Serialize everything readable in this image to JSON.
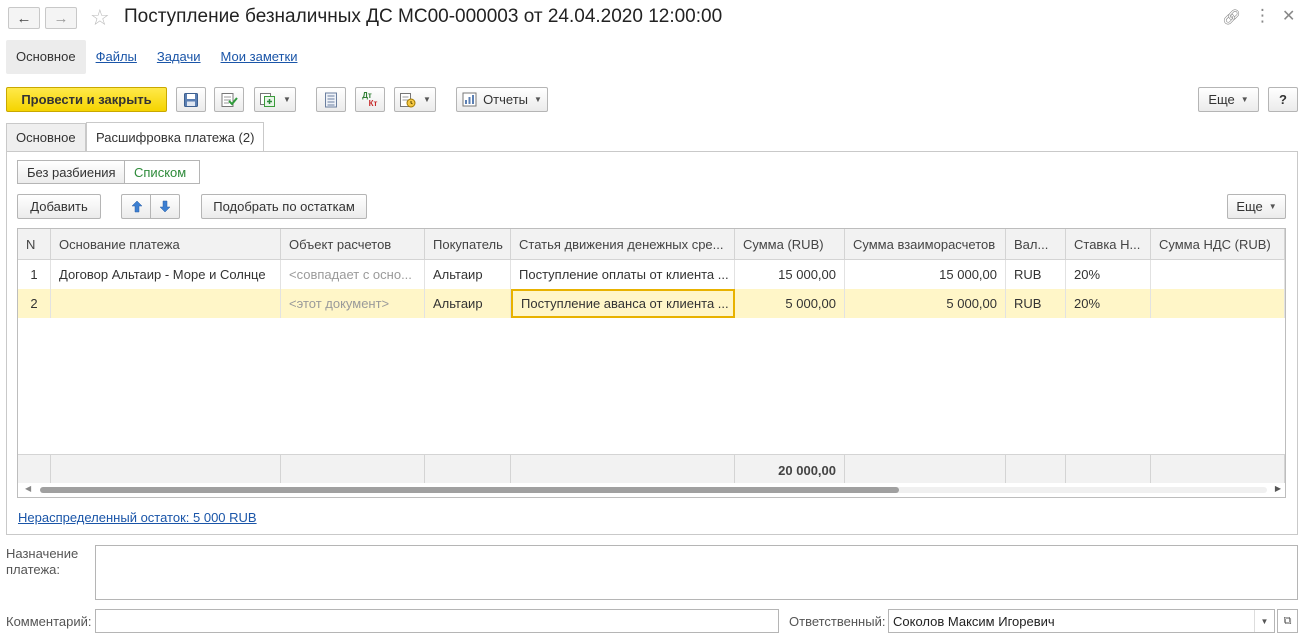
{
  "window": {
    "title": "Поступление безналичных ДС МС00-000003 от 24.04.2020 12:00:00"
  },
  "section_tabs": [
    {
      "label": "Основное"
    },
    {
      "label": "Файлы"
    },
    {
      "label": "Задачи"
    },
    {
      "label": "Мои заметки"
    }
  ],
  "toolbar": {
    "post_close": "Провести и закрыть",
    "reports": "Отчеты",
    "more": "Еще",
    "help": "?",
    "dtkt_top": "Дт",
    "dtkt_bottom": "Кт"
  },
  "tabs": [
    {
      "label": "Основное"
    },
    {
      "label": "Расшифровка платежа (2)"
    }
  ],
  "view_toggle": {
    "no_split": "Без разбиения",
    "list": "Списком"
  },
  "table_toolbar": {
    "add": "Добавить",
    "pick_by_balance": "Подобрать по остаткам",
    "more": "Еще"
  },
  "table": {
    "columns": [
      "N",
      "Основание платежа",
      "Объект расчетов",
      "Покупатель",
      "Статья движения денежных сре...",
      "Сумма (RUB)",
      "Сумма взаиморасчетов",
      "Вал...",
      "Ставка Н...",
      "Сумма НДС (RUB)"
    ],
    "rows": [
      [
        "1",
        "Договор Альтаир - Море и Солнце",
        "<совпадает с осно...",
        "Альтаир",
        "Поступление оплаты от клиента ...",
        "15 000,00",
        "15 000,00",
        "RUB",
        "20%",
        ""
      ],
      [
        "2",
        "",
        "<этот документ>",
        "Альтаир",
        "Поступление аванса от клиента ...",
        "5 000,00",
        "5 000,00",
        "RUB",
        "20%",
        ""
      ]
    ],
    "total": "20 000,00",
    "scroll_fraction": 0.7
  },
  "unallocated": "Нераспределенный остаток: 5 000 RUB",
  "form": {
    "purpose_label": "Назначение платежа:",
    "purpose_value": "",
    "comment_label": "Комментарий:",
    "comment_value": "",
    "responsible_label": "Ответственный:",
    "responsible_value": "Соколов Максим Игоревич"
  }
}
